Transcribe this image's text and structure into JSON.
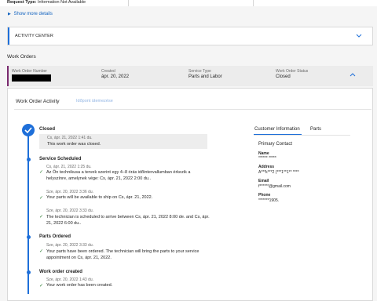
{
  "request_type": {
    "label": "Request Type:",
    "value": "Information Not Available"
  },
  "show_more": "Show more details",
  "activity_center": "ACTIVITY CENTER",
  "work_orders_title": "Work Orders",
  "work_order": {
    "number_label": "Work Order Number",
    "created_label": "Created",
    "created_value": "ápr. 20, 2022",
    "service_type_label": "Service Type",
    "service_type_value": "Parts and Labor",
    "status_label": "Work Order Status",
    "status_value": "Closed"
  },
  "activity": {
    "title": "Work Order Activity",
    "tab2": "Időpont ütemezése"
  },
  "timeline": [
    {
      "title": "Closed",
      "entries": [
        {
          "time": "Cs, ápr. 21, 2022 1:41 du.",
          "text": "This work order was closed."
        }
      ]
    },
    {
      "title": "Service Scheduled",
      "entries": [
        {
          "time": "Cs, ápr. 21, 2022 1:25 du.",
          "text": "Az Ön technikusa a tervek szerint egy 4–8 órás időintervallumban érkezik a helyszínre, amelynek vége: Cs, ápr. 21, 2022 2:00 du.."
        },
        {
          "time": "Sze, ápr. 20, 2022 3:36 du.",
          "text": "Your parts will be available to ship on Cs, ápr. 21, 2022."
        },
        {
          "time": "Sze, ápr. 20, 2022 3:33 du.",
          "text": "The technician is scheduled to arrive between Cs, ápr. 21, 2022 8:00 de. and Cs, ápr. 21, 2022 6:00 du.."
        }
      ]
    },
    {
      "title": "Parts Ordered",
      "entries": [
        {
          "time": "Sze, ápr. 20, 2022 3:33 du.",
          "text": "Your parts have been ordered. The technician will bring the parts to your service appointment on Cs, ápr. 21, 2022."
        }
      ]
    },
    {
      "title": "Work order created",
      "entries": [
        {
          "time": "Sze, ápr. 20, 2022 1:43 du.",
          "text": "Your work order has been created."
        }
      ]
    }
  ],
  "customer": {
    "tab_info": "Customer Information",
    "tab_parts": "Parts",
    "primary_contact": "Primary Contact",
    "name_label": "Name",
    "name_value": "****** *****",
    "address_label": "Address",
    "address_value": "A***k***2 (***1**1** ****",
    "email_label": "Email",
    "email_value": "f******@gmail.com",
    "phone_label": "Phone",
    "phone_value": "*******1905."
  },
  "colors": {
    "accent": "#1e6fd9",
    "link": "#1565c0",
    "check": "#2e7d32"
  }
}
